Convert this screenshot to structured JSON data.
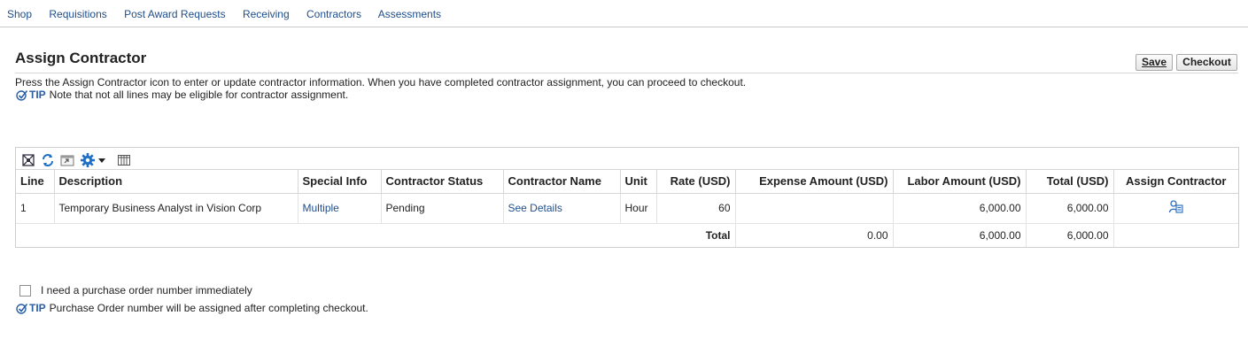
{
  "nav": {
    "items": [
      "Shop",
      "Requisitions",
      "Post Award Requests",
      "Receiving",
      "Contractors",
      "Assessments"
    ]
  },
  "header": {
    "title": "Assign Contractor",
    "save_label": "Save",
    "checkout_label": "Checkout"
  },
  "instructions": "Press the Assign Contractor icon to enter or update contractor information. When you have completed contractor assignment, you can proceed to checkout.",
  "tip1": {
    "label": "TIP",
    "text": "Note that not all lines may be eligible for contractor assignment."
  },
  "toolbar": {
    "icons": [
      "detach-icon",
      "refresh-icon",
      "export-icon",
      "gear-icon",
      "dropdown-arrow-icon",
      "columns-icon"
    ]
  },
  "table": {
    "headers": [
      "Line",
      "Description",
      "Special Info",
      "Contractor Status",
      "Contractor Name",
      "Unit",
      "Rate (USD)",
      "Expense Amount (USD)",
      "Labor Amount (USD)",
      "Total (USD)",
      "Assign Contractor"
    ],
    "rows": [
      {
        "line": "1",
        "description": "Temporary Business Analyst in Vision Corp",
        "special_info": "Multiple",
        "status": "Pending",
        "contractor_name": "See Details",
        "unit": "Hour",
        "rate": "60",
        "expense": "",
        "labor": "6,000.00",
        "total": "6,000.00"
      }
    ],
    "total_row": {
      "label": "Total",
      "expense": "0.00",
      "labor": "6,000.00",
      "total": "6,000.00"
    }
  },
  "po_checkbox": {
    "label": "I need a purchase order number immediately",
    "checked": false
  },
  "tip2": {
    "label": "TIP",
    "text": "Purchase Order number will be assigned after completing checkout."
  },
  "colors": {
    "link": "#1f4e8c",
    "tip": "#2a5fa6",
    "border": "#cfcfcf"
  }
}
